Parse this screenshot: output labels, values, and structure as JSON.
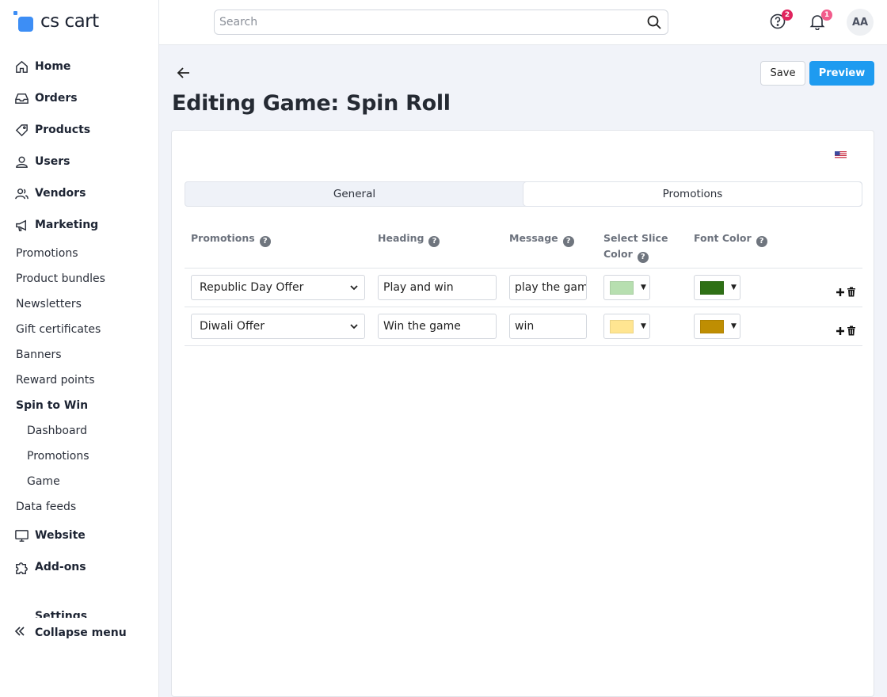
{
  "brand": {
    "name": "cs cart",
    "color": "#3d8ef5"
  },
  "sidebar": {
    "main_items": [
      {
        "label": "Home",
        "icon": "home-icon"
      },
      {
        "label": "Orders",
        "icon": "inbox-icon"
      },
      {
        "label": "Products",
        "icon": "tag-icon"
      },
      {
        "label": "Users",
        "icon": "user-icon"
      },
      {
        "label": "Vendors",
        "icon": "users-icon"
      },
      {
        "label": "Marketing",
        "icon": "megaphone-icon"
      }
    ],
    "marketing_sub": [
      "Promotions",
      "Product bundles",
      "Newsletters",
      "Gift certificates",
      "Banners",
      "Reward points",
      "Spin to Win"
    ],
    "spin_sub": [
      "Dashboard",
      "Promotions",
      "Game"
    ],
    "data_feeds": "Data feeds",
    "lower_items": [
      {
        "label": "Website",
        "icon": "monitor-icon"
      },
      {
        "label": "Add-ons",
        "icon": "puzzle-icon"
      }
    ],
    "cut_item": "Settings",
    "collapse_label": "Collapse menu"
  },
  "topbar": {
    "search_placeholder": "Search",
    "help_badge": "2",
    "notif_badge": "1",
    "avatar_initials": "AA"
  },
  "page": {
    "title": "Editing Game: Spin Roll",
    "save_label": "Save",
    "preview_label": "Preview",
    "accent": "#1e9bf0"
  },
  "tabs": [
    {
      "label": "General",
      "active": false
    },
    {
      "label": "Promotions",
      "active": true
    }
  ],
  "table": {
    "headers": {
      "promotions": "Promotions",
      "heading": "Heading",
      "message": "Message",
      "slice_color_line1": "Select Slice",
      "slice_color_line2": "Color",
      "font_color": "Font Color"
    },
    "rows": [
      {
        "promotion": "Republic Day Offer",
        "heading": "Play and win",
        "message": "play the game",
        "slice_color": "#b7dfb0",
        "font_color": "#2e7015"
      },
      {
        "promotion": "Diwali Offer",
        "heading": "Win the game",
        "message": "win",
        "slice_color": "#ffe591",
        "font_color": "#bf8e02"
      }
    ]
  }
}
